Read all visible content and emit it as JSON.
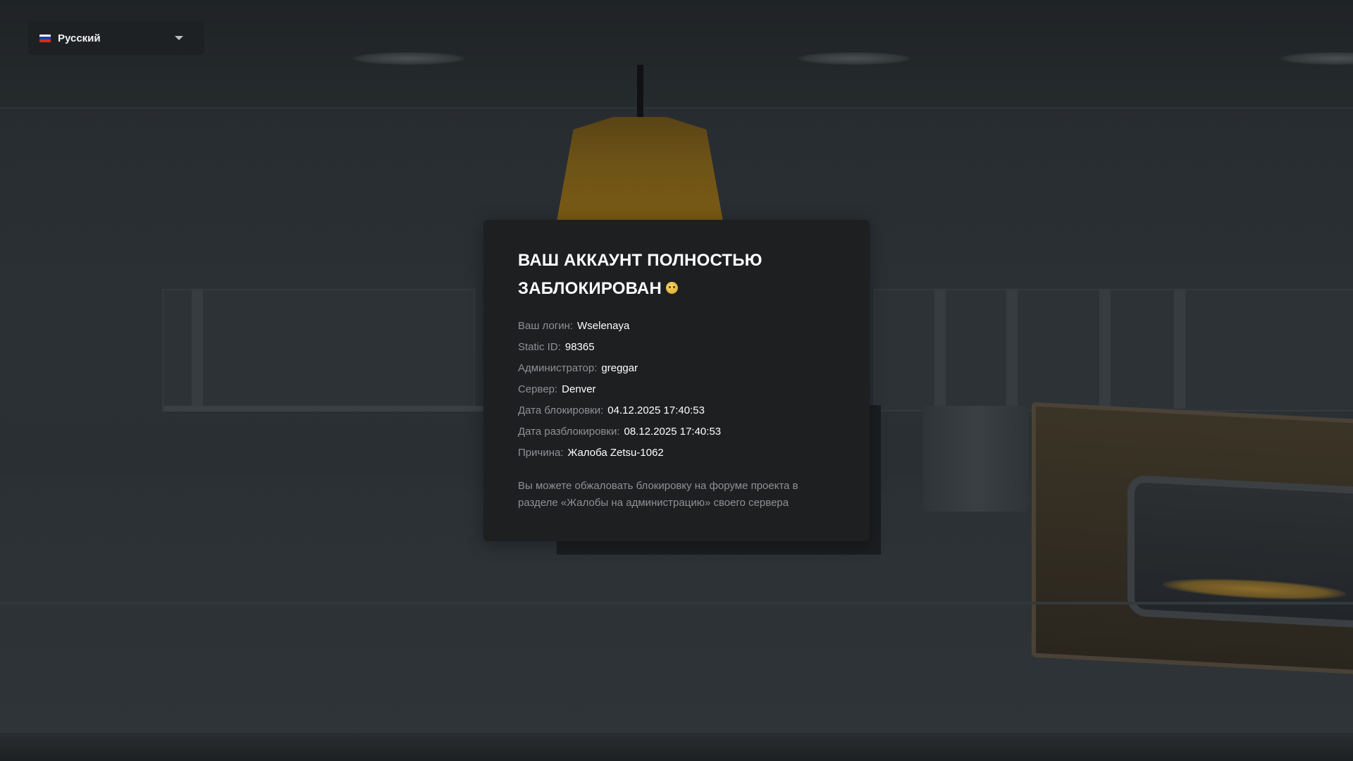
{
  "language_selector": {
    "label": "Русский",
    "flag_colors": [
      "#ffffff",
      "#1c3faa",
      "#d52b1e"
    ]
  },
  "ban_notice": {
    "title": "ВАШ АККАУНТ ПОЛНОСТЬЮ ЗАБЛОКИРОВАН",
    "emoji": "sad-face-emoji",
    "fields": [
      {
        "label": "Ваш логин:",
        "value": "Wselenaya"
      },
      {
        "label": "Static ID:",
        "value": "98365"
      },
      {
        "label": "Администратор:",
        "value": "greggar"
      },
      {
        "label": "Сервер:",
        "value": "Denver"
      },
      {
        "label": "Дата блокировки:",
        "value": "04.12.2025 17:40:53"
      },
      {
        "label": "Дата разблокировки:",
        "value": "08.12.2025 17:40:53"
      },
      {
        "label": "Причина:",
        "value": "Жалоба Zetsu-1062"
      }
    ],
    "appeal_note": "Вы можете обжаловать блокировку на форуме проекта в разделе «Жалобы на администрацию» своего сервера"
  },
  "colors": {
    "modal_bg": "#1d1f21",
    "label": "#8e9194",
    "value": "#ffffff"
  }
}
